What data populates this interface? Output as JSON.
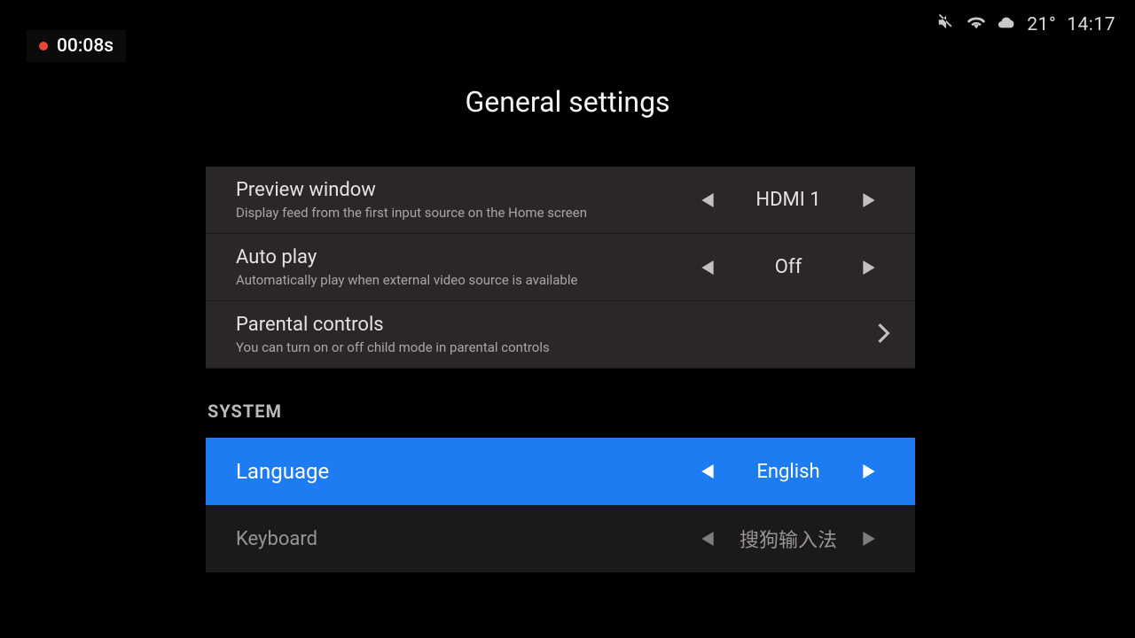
{
  "recording": {
    "timer": "00:08s"
  },
  "status": {
    "temperature": "21°",
    "time": "14:17"
  },
  "page": {
    "title": "General settings"
  },
  "group1": {
    "previewWindow": {
      "title": "Preview window",
      "sub": "Display feed from the first input source on the Home screen",
      "value": "HDMI 1"
    },
    "autoPlay": {
      "title": "Auto play",
      "sub": "Automatically play when external video source is available",
      "value": "Off"
    },
    "parentalControls": {
      "title": "Parental controls",
      "sub": "You can turn on or off child mode in parental controls"
    }
  },
  "section_system_label": "SYSTEM",
  "system": {
    "language": {
      "title": "Language",
      "value": "English"
    },
    "keyboard": {
      "title": "Keyboard",
      "value": "搜狗输入法"
    }
  }
}
